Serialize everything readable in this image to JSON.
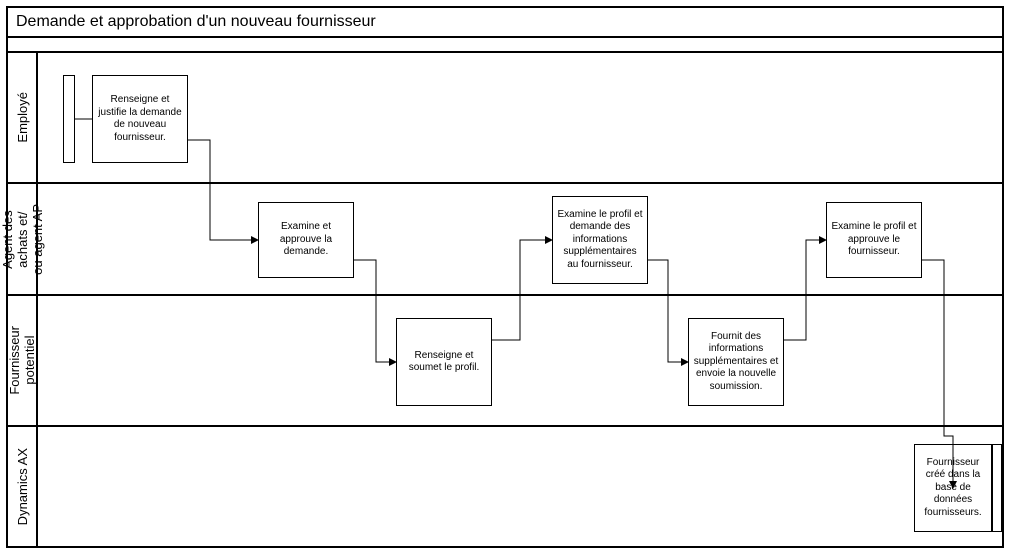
{
  "title": "Demande et approbation d'un nouveau fournisseur",
  "lanes": {
    "employe": "Employé",
    "agent": "Agent des\nachats et/\nou agent AP",
    "fournisseur": "Fournisseur\npotentiel",
    "dynamics": "Dynamics AX"
  },
  "steps": {
    "s1": "Renseigne et justifie la demande de nouveau fournisseur.",
    "s2": "Examine et approuve la demande.",
    "s3": "Renseigne et soumet le profil.",
    "s4": "Examine le profil et demande des informations supplémentaires au fournisseur.",
    "s5": "Fournit des informations supplémentaires et envoie la nouvelle soumission.",
    "s6": "Examine le profil et approuve le fournisseur.",
    "s7": "Fournisseur créé dans la base de données fournisseurs."
  },
  "chart_data": {
    "type": "table",
    "title": "Demande et approbation d'un nouveau fournisseur",
    "lanes": [
      "Employé",
      "Agent des achats et/ou agent AP",
      "Fournisseur potentiel",
      "Dynamics AX"
    ],
    "steps": [
      {
        "lane": "Employé",
        "text": "Renseigne et justifie la demande de nouveau fournisseur."
      },
      {
        "lane": "Agent des achats et/ou agent AP",
        "text": "Examine et approuve la demande."
      },
      {
        "lane": "Fournisseur potentiel",
        "text": "Renseigne et soumet le profil."
      },
      {
        "lane": "Agent des achats et/ou agent AP",
        "text": "Examine le profil et demande des informations supplémentaires au fournisseur."
      },
      {
        "lane": "Fournisseur potentiel",
        "text": "Fournit des informations supplémentaires et envoie la nouvelle soumission."
      },
      {
        "lane": "Agent des achats et/ou agent AP",
        "text": "Examine le profil et approuve le fournisseur."
      },
      {
        "lane": "Dynamics AX",
        "text": "Fournisseur créé dans la base de données fournisseurs."
      }
    ]
  }
}
